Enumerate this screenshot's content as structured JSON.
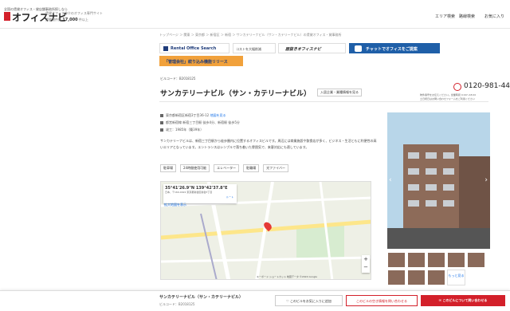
{
  "header": {
    "logo_small": "全国の賃貸オフィス・貸店舗事務所探しなら",
    "logo_text": "オフィスナビ",
    "tagline": "賃貸オフィス仲介のオフィス専門サイト",
    "count_label": "掲載物件数",
    "count_value": "17,000",
    "count_suffix": "件以上",
    "nav": [
      "エリア検索",
      "路線検索",
      "お気に入り"
    ]
  },
  "breadcrumb": "トップページ ＞ 関東 ＞ 東京都 ＞ 新宿区 ＞ 新宿 ＞ サンカテリーナビル（サン・カテリーナビル）の賃貸オフィス・貸事務所",
  "banners": {
    "b1": "Rental Office Search",
    "b2": "コストを大幅削減",
    "b3": "居抜きオフィスナビ",
    "b4": "チャットでオフィスをご提案",
    "b5": "「管理会社」絞り込み機能リリース"
  },
  "building": {
    "code": "ビルコード：B2018125",
    "title": "サンカテリーナビル（サン・カテリーナビル）",
    "badge": "入居企業・業種情報を見る",
    "phone": "0120-981-440",
    "phone_note": [
      "物件番号をお伝えください。営業時間 9:00～18:00",
      "土日祝日はお問い合わせフォームをご利用ください"
    ],
    "address": "東京都新宿区新宿3丁目36-12",
    "map_link": "地図を見る",
    "station": "都営新宿線 新宿三丁目駅 徒歩4分、新宿駅 徒歩5分",
    "built": "竣工：1985年（築39年）",
    "description": "サンカテリーナビルは、新宿三丁目駅から徒歩圏内に位置するオフィスビルです。周辺には商業施設や飲食店が多く、ビジネス・生活ともに利便性の高いエリアとなっています。エントランスはシンプルで落ち着いた雰囲気で、来客対応にも適しています。",
    "tags": [
      "駐車場",
      "24時間使用可能",
      "エレベーター",
      "駐輪場",
      "光ファイバー"
    ]
  },
  "map": {
    "coords": "35°41'26.9\"N 139°42'37.8\"E",
    "address": "日本、〒160-0022 東京都新宿区新宿3丁目",
    "route_label": "ルート",
    "enlarge": "拡大地図を表示",
    "footer": "キーボード ショートカット  地図データ ©2024 Google"
  },
  "photo": {
    "more_label": "もっと見る"
  },
  "footer": {
    "title": "サンカテリーナビル（サン・カテリーナビル）",
    "code": "ビルコード：B2018125",
    "fav": "このビルをお気に入りに追加",
    "inquiry": "このビルの空き情報を問い合わせる",
    "cta": "このビルについて問い合わせる"
  },
  "colors": {
    "brand": "#d3202a",
    "cta": "#d3202a",
    "link": "#1a73e8"
  }
}
